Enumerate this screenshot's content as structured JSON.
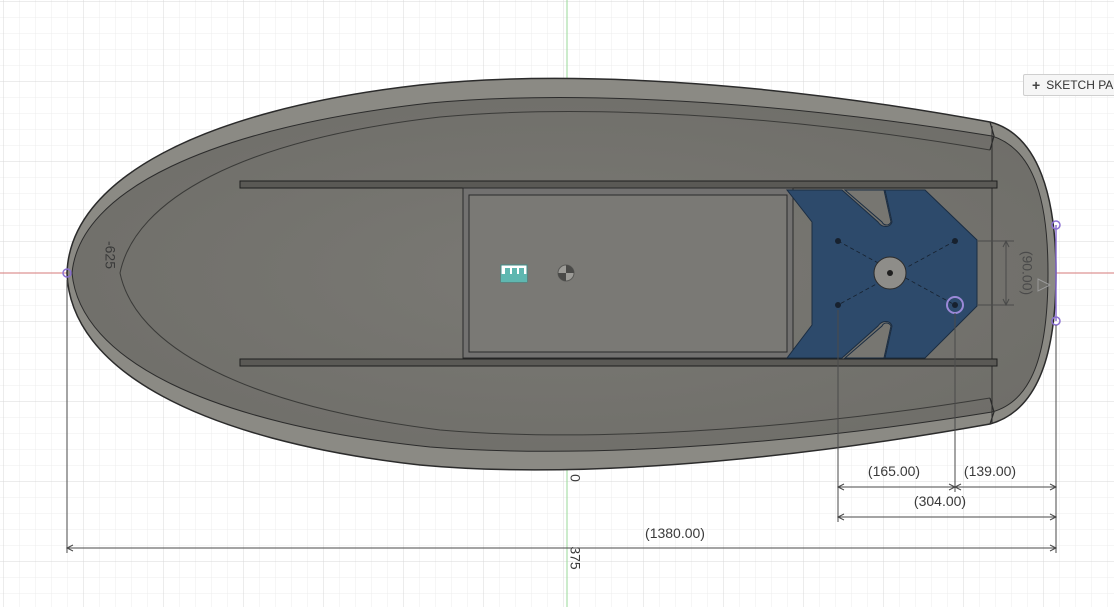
{
  "toolbar": {
    "sketch_palette_plus": "+",
    "sketch_palette_label": "SKETCH PAL"
  },
  "dimensions": {
    "left_vertical": "-625",
    "center_vertical_top": "0",
    "center_vertical_bottom": "375",
    "dim_165": "(165.00)",
    "dim_139": "(139.00)",
    "dim_304": "(304.00)",
    "dim_1380": "(1380.00)",
    "dim_90": "(90.00)"
  },
  "colors": {
    "grid_minor": "#eaeaea",
    "grid_major": "#d6d6d6",
    "axis_x": "#d9534f",
    "axis_y": "#6fcf6f",
    "body_fill": "#777671",
    "body_rim": "#8a8983",
    "body_outline": "#2b2b2b",
    "mount_plate": "#2d4a6b",
    "dimension_line": "#333333",
    "sketch_point": "#8a6fd1",
    "component_icon": "#5fb7b0"
  },
  "icons": {
    "component_icon": "component-icon",
    "origin_icon": "origin-icon",
    "constraint_icon": "triangle-constraint-icon"
  }
}
